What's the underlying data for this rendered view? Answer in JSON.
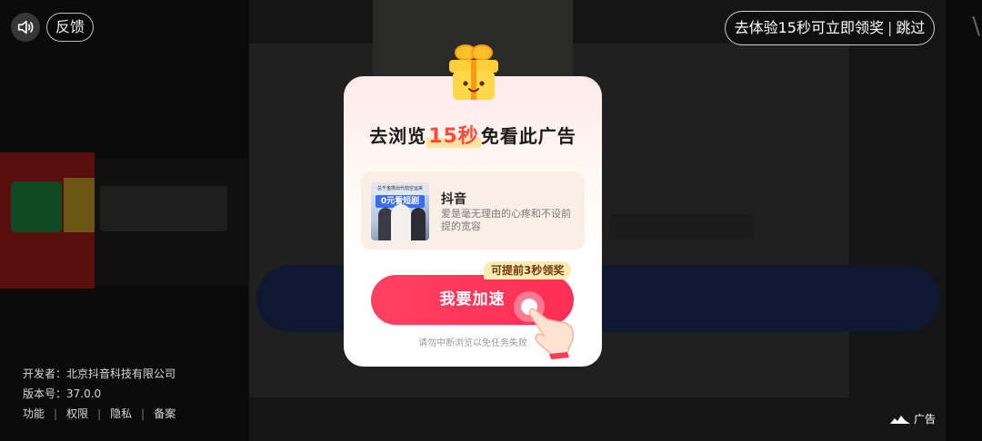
{
  "top_bar": {
    "sound_icon": "speaker-icon",
    "feedback_label": "反馈",
    "skip_prompt": "去体验15秒可立即领奖",
    "skip_separator": "|",
    "skip_label": "跳过"
  },
  "developer_info": {
    "developer_label": "开发者：",
    "developer_name": "北京抖音科技有限公司",
    "version_label": "版本号：",
    "version_value": "37.0.0",
    "links": [
      "功能",
      "权限",
      "隐私",
      "备案"
    ]
  },
  "ad_tag": {
    "label": "广告"
  },
  "modal": {
    "title_prefix": "去浏览",
    "title_highlight": "15秒",
    "title_suffix": "免看此广告",
    "app": {
      "name": "抖音",
      "description": "爱是毫无理由的心疼和不设前提的宽容",
      "thumb_caption": "总千金携出代劫空运来",
      "thumb_badge": "0元看短剧"
    },
    "speed_button_label": "我要加速",
    "tip_badge": "可提前3秒领奖",
    "warning": "请勿中断浏览以免任务失败"
  },
  "colors": {
    "accent_red": "#ff2e55",
    "highlight_orange": "#ff4b3a",
    "tip_badge_bg": "#ffeab0"
  }
}
